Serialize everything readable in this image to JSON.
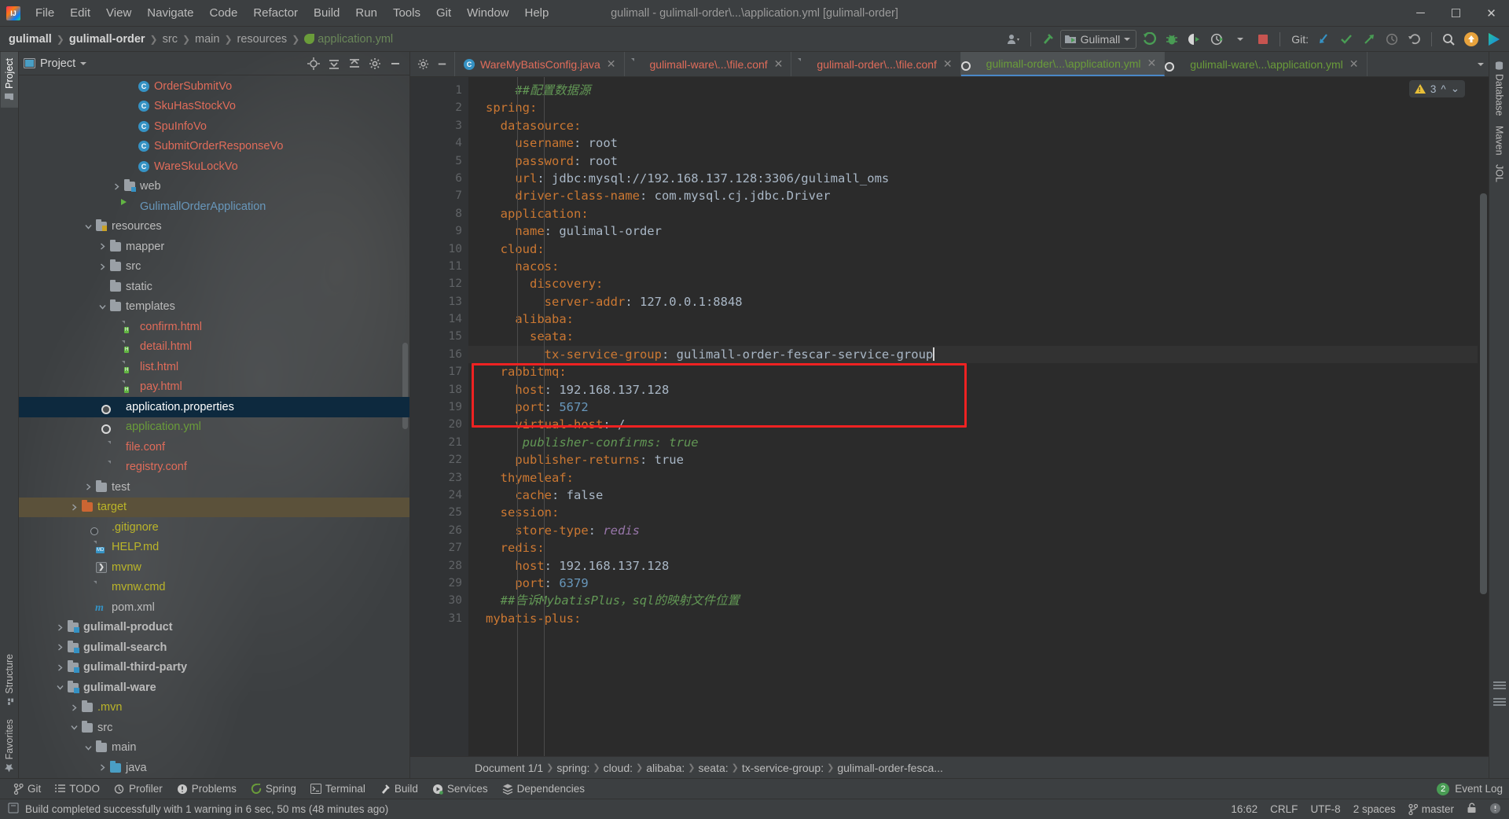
{
  "window": {
    "title": "gulimall - gulimall-order\\...\\application.yml [gulimall-order]",
    "minimize": "–",
    "maximize": "❐",
    "close": "✕"
  },
  "menubar": [
    {
      "label": "File"
    },
    {
      "label": "Edit"
    },
    {
      "label": "View"
    },
    {
      "label": "Navigate"
    },
    {
      "label": "Code"
    },
    {
      "label": "Refactor"
    },
    {
      "label": "Build"
    },
    {
      "label": "Run"
    },
    {
      "label": "Tools"
    },
    {
      "label": "Git"
    },
    {
      "label": "Window"
    },
    {
      "label": "Help"
    }
  ],
  "navbar": {
    "crumbs": [
      {
        "label": "gulimall",
        "style": "b"
      },
      {
        "label": "gulimall-order",
        "style": "b"
      },
      {
        "label": "src",
        "style": "dim"
      },
      {
        "label": "main",
        "style": "dim"
      },
      {
        "label": "resources",
        "style": "dim"
      },
      {
        "label": "application.yml",
        "style": "file"
      }
    ],
    "run_config": "Gulimall",
    "git_label": "Git:",
    "icons": [
      "user-avatar-icon",
      "build-hammer-icon",
      "run-icon",
      "debug-icon",
      "run-with-coverage-icon",
      "profiler-icon",
      "stop-icon",
      "git-update-icon",
      "git-commit-icon",
      "git-push-icon",
      "git-history-icon",
      "git-rollback-icon",
      "search-everywhere-icon",
      "update-available-icon",
      "share-icon"
    ]
  },
  "left_strip": {
    "top": [
      {
        "label": "Project",
        "active": true
      }
    ],
    "bottom": [
      {
        "label": "Structure"
      },
      {
        "label": "Favorites"
      }
    ]
  },
  "right_strip": [
    {
      "label": "Database"
    },
    {
      "label": "Maven"
    },
    {
      "label": "JOL"
    }
  ],
  "project_panel": {
    "title": "Project",
    "tools": [
      "locate-icon",
      "expand-all-icon",
      "collapse-all-icon",
      "settings-gear-icon",
      "hide-icon"
    ],
    "tree": [
      {
        "indent": 7,
        "arrow": "none",
        "icon": "class-icon",
        "label": "OrderSubmitVo",
        "color": "c-red"
      },
      {
        "indent": 7,
        "arrow": "none",
        "icon": "class-icon",
        "label": "SkuHasStockVo",
        "color": "c-red"
      },
      {
        "indent": 7,
        "arrow": "none",
        "icon": "class-icon",
        "label": "SpuInfoVo",
        "color": "c-red"
      },
      {
        "indent": 7,
        "arrow": "none",
        "icon": "class-icon",
        "label": "SubmitOrderResponseVo",
        "color": "c-red"
      },
      {
        "indent": 7,
        "arrow": "none",
        "icon": "class-icon",
        "label": "WareSkuLockVo",
        "color": "c-red"
      },
      {
        "indent": 6,
        "arrow": "right",
        "icon": "folder-src-icon",
        "label": "web",
        "color": "c-grey"
      },
      {
        "indent": 6,
        "arrow": "none",
        "icon": "springboot-icon",
        "label": "GulimallOrderApplication",
        "color": "c-blue"
      },
      {
        "indent": 4,
        "arrow": "down",
        "icon": "folder-res-icon",
        "label": "resources",
        "color": "c-grey"
      },
      {
        "indent": 5,
        "arrow": "right",
        "icon": "folder-icon",
        "label": "mapper",
        "color": "c-grey"
      },
      {
        "indent": 5,
        "arrow": "right",
        "icon": "folder-icon",
        "label": "src",
        "color": "c-grey"
      },
      {
        "indent": 5,
        "arrow": "none",
        "icon": "folder-icon",
        "label": "static",
        "color": "c-grey"
      },
      {
        "indent": 5,
        "arrow": "down",
        "icon": "folder-icon",
        "label": "templates",
        "color": "c-grey"
      },
      {
        "indent": 6,
        "arrow": "none",
        "icon": "html-file-icon",
        "label": "confirm.html",
        "color": "c-red"
      },
      {
        "indent": 6,
        "arrow": "none",
        "icon": "html-file-icon",
        "label": "detail.html",
        "color": "c-red"
      },
      {
        "indent": 6,
        "arrow": "none",
        "icon": "html-file-icon",
        "label": "list.html",
        "color": "c-red"
      },
      {
        "indent": 6,
        "arrow": "none",
        "icon": "html-file-icon",
        "label": "pay.html",
        "color": "c-red"
      },
      {
        "indent": 5,
        "arrow": "none",
        "icon": "spring-file-icon",
        "label": "application.properties",
        "color": "c-white",
        "selected": true
      },
      {
        "indent": 5,
        "arrow": "none",
        "icon": "spring-file-icon",
        "label": "application.yml",
        "color": "c-green"
      },
      {
        "indent": 5,
        "arrow": "none",
        "icon": "conf-file-icon",
        "label": "file.conf",
        "color": "c-red"
      },
      {
        "indent": 5,
        "arrow": "none",
        "icon": "conf-file-icon",
        "label": "registry.conf",
        "color": "c-red"
      },
      {
        "indent": 4,
        "arrow": "right",
        "icon": "folder-icon",
        "label": "test",
        "color": "c-grey"
      },
      {
        "indent": 3,
        "arrow": "right",
        "icon": "folder-orange-icon",
        "label": "target",
        "color": "c-yellow",
        "target": true
      },
      {
        "indent": 4,
        "arrow": "none",
        "icon": "gitignore-icon",
        "label": ".gitignore",
        "color": "c-yellow"
      },
      {
        "indent": 4,
        "arrow": "none",
        "icon": "md-file-icon",
        "label": "HELP.md",
        "color": "c-yellow"
      },
      {
        "indent": 4,
        "arrow": "none",
        "icon": "shell-icon",
        "label": "mvnw",
        "color": "c-yellow"
      },
      {
        "indent": 4,
        "arrow": "none",
        "icon": "conf-file-icon",
        "label": "mvnw.cmd",
        "color": "c-yellow"
      },
      {
        "indent": 4,
        "arrow": "none",
        "icon": "maven-icon",
        "label": "pom.xml",
        "color": "c-grey"
      },
      {
        "indent": 2,
        "arrow": "right",
        "icon": "folder-mod-icon",
        "label": "gulimall-product",
        "color": "c-grey",
        "bold": true
      },
      {
        "indent": 2,
        "arrow": "right",
        "icon": "folder-mod-icon",
        "label": "gulimall-search",
        "color": "c-grey",
        "bold": true
      },
      {
        "indent": 2,
        "arrow": "right",
        "icon": "folder-mod-icon",
        "label": "gulimall-third-party",
        "color": "c-grey",
        "bold": true
      },
      {
        "indent": 2,
        "arrow": "down",
        "icon": "folder-mod-icon",
        "label": "gulimall-ware",
        "color": "c-grey",
        "bold": true
      },
      {
        "indent": 3,
        "arrow": "right",
        "icon": "folder-icon",
        "label": ".mvn",
        "color": "c-yellow"
      },
      {
        "indent": 3,
        "arrow": "down",
        "icon": "folder-icon",
        "label": "src",
        "color": "c-grey"
      },
      {
        "indent": 4,
        "arrow": "down",
        "icon": "folder-icon",
        "label": "main",
        "color": "c-grey"
      },
      {
        "indent": 5,
        "arrow": "right",
        "icon": "folder-blue-icon",
        "label": "java",
        "color": "c-grey"
      }
    ]
  },
  "editor": {
    "tabs": [
      {
        "icon": "class-icon",
        "label": "WareMyBatisConfig.java",
        "color": "c-red",
        "active": false
      },
      {
        "icon": "conf-file-icon",
        "label": "gulimall-ware\\...\\file.conf",
        "color": "c-red",
        "active": false
      },
      {
        "icon": "conf-file-icon",
        "label": "gulimall-order\\...\\file.conf",
        "color": "c-red",
        "active": false
      },
      {
        "icon": "spring-file-icon",
        "label": "gulimall-order\\...\\application.yml",
        "color": "c-green",
        "active": true
      },
      {
        "icon": "spring-file-icon",
        "label": "gulimall-ware\\...\\application.yml",
        "color": "c-green",
        "active": false
      }
    ],
    "warning_count": "3",
    "lines": [
      {
        "n": 1,
        "fold": "",
        "text": "    ##配置数据源",
        "cls": "cmt"
      },
      {
        "n": 2,
        "fold": "open",
        "text": "spring:",
        "cls": "key",
        "indent": 0
      },
      {
        "n": 3,
        "fold": "open2",
        "text": "  datasource:",
        "cls": "key",
        "indent": 1
      },
      {
        "n": 4,
        "fold": "",
        "key": "    username",
        "val": "root",
        "indent": 2
      },
      {
        "n": 5,
        "fold": "",
        "key": "    password",
        "val": "root",
        "indent": 2
      },
      {
        "n": 6,
        "fold": "",
        "key": "    url",
        "val": "jdbc:mysql://192.168.137.128:3306/gulimall_oms",
        "indent": 2
      },
      {
        "n": 7,
        "fold": "close2",
        "key": "    driver-class-name",
        "val": "com.mysql.cj.jdbc.Driver",
        "indent": 2
      },
      {
        "n": 8,
        "fold": "open2",
        "text": "  application:",
        "cls": "key",
        "indent": 1
      },
      {
        "n": 9,
        "fold": "",
        "key": "    name",
        "val": "gulimall-order",
        "indent": 2
      },
      {
        "n": 10,
        "fold": "open2",
        "text": "  cloud:",
        "cls": "key",
        "indent": 1
      },
      {
        "n": 11,
        "fold": "open3",
        "text": "    nacos:",
        "cls": "key",
        "indent": 2
      },
      {
        "n": 12,
        "fold": "open4",
        "text": "      discovery:",
        "cls": "key",
        "indent": 3
      },
      {
        "n": 13,
        "fold": "",
        "key": "        server-addr",
        "val": "127.0.0.1:8848",
        "indent": 4
      },
      {
        "n": 14,
        "fold": "open3",
        "text": "    alibaba:",
        "cls": "key",
        "indent": 2
      },
      {
        "n": 15,
        "fold": "open4",
        "text": "      seata:",
        "cls": "key",
        "indent": 3
      },
      {
        "n": 16,
        "fold": "",
        "key": "        tx-service-group",
        "val": "gulimall-order-fescar-service-group",
        "indent": 4,
        "current": true,
        "caret": true
      },
      {
        "n": 17,
        "fold": "open2",
        "text": "  rabbitmq:",
        "cls": "key",
        "indent": 1
      },
      {
        "n": 18,
        "fold": "",
        "key": "    host",
        "val": "192.168.137.128",
        "indent": 2
      },
      {
        "n": 19,
        "fold": "",
        "key": "    port",
        "valnum": "5672",
        "indent": 2
      },
      {
        "n": 20,
        "fold": "",
        "key": "    virtual-host",
        "val": "/",
        "indent": 2
      },
      {
        "n": 21,
        "fold": "hash",
        "text": "     publisher-confirms: true",
        "cls": "cmt",
        "indent": 2
      },
      {
        "n": 22,
        "fold": "close2",
        "key": "    publisher-returns",
        "val": "true",
        "indent": 2
      },
      {
        "n": 23,
        "fold": "open2",
        "text": "  thymeleaf:",
        "cls": "key",
        "indent": 1
      },
      {
        "n": 24,
        "fold": "close2",
        "key": "    cache",
        "val": "false",
        "indent": 2
      },
      {
        "n": 25,
        "fold": "open2",
        "text": "  session:",
        "cls": "key",
        "indent": 1
      },
      {
        "n": 26,
        "fold": "close2",
        "key": "    store-type",
        "valital": "redis",
        "indent": 2
      },
      {
        "n": 27,
        "fold": "open2",
        "text": "  redis:",
        "cls": "key",
        "indent": 1
      },
      {
        "n": 28,
        "fold": "",
        "key": "    host",
        "val": "192.168.137.128",
        "indent": 2
      },
      {
        "n": 29,
        "fold": "close2",
        "key": "    port",
        "valnum": "6379",
        "indent": 2
      },
      {
        "n": 30,
        "fold": "",
        "text": "  ##告诉MybatisPlus，sql的映射文件位置",
        "cls": "cmt"
      },
      {
        "n": 31,
        "fold": "open",
        "text": "mybatis-plus:",
        "cls": "key",
        "indent": 0
      }
    ],
    "breadcrumbs": [
      "Document 1/1",
      "spring:",
      "cloud:",
      "alibaba:",
      "seata:",
      "tx-service-group:",
      "gulimall-order-fesca..."
    ]
  },
  "bottom_tools": [
    {
      "icon": "git-branch-icon",
      "label": "Git"
    },
    {
      "icon": "todo-icon",
      "label": "TODO"
    },
    {
      "icon": "profiler-icon",
      "label": "Profiler"
    },
    {
      "icon": "problems-icon",
      "label": "Problems"
    },
    {
      "icon": "spring-icon",
      "label": "Spring"
    },
    {
      "icon": "terminal-icon",
      "label": "Terminal"
    },
    {
      "icon": "build-hammer-icon",
      "label": "Build"
    },
    {
      "icon": "services-icon",
      "label": "Services"
    },
    {
      "icon": "dependencies-icon",
      "label": "Dependencies"
    }
  ],
  "event_log": {
    "count": "2",
    "label": "Event Log"
  },
  "statusbar": {
    "message": "Build completed successfully with 1 warning in 6 sec, 50 ms (48 minutes ago)",
    "position": "16:62",
    "line_sep": "CRLF",
    "encoding": "UTF-8",
    "indent": "2 spaces",
    "branch": "master"
  },
  "colors": {
    "accent_blue": "#4a88c7",
    "selection": "#0d293e",
    "target_row": "#5b513a",
    "annotation_red": "#ee2222",
    "editor_bg": "#2b2b2b",
    "panel_bg": "#3c3f41",
    "key_orange": "#cc7832",
    "comment_green": "#629755",
    "number_blue": "#6897bb"
  }
}
